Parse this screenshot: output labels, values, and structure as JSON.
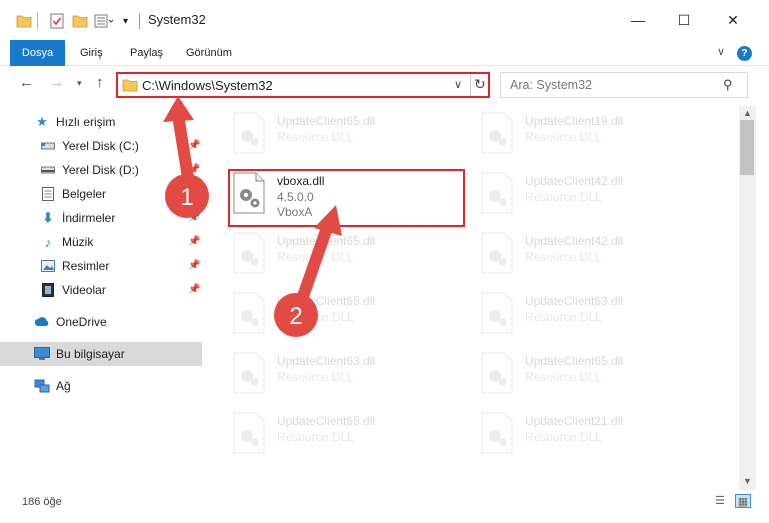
{
  "window": {
    "title": "System32",
    "minimize_glyph": "—",
    "maximize_glyph": "☐",
    "close_glyph": "✕"
  },
  "ribbon": {
    "tabs": [
      {
        "label": "Dosya"
      },
      {
        "label": "Giriş"
      },
      {
        "label": "Paylaş"
      },
      {
        "label": "Görünüm"
      }
    ],
    "help_glyph": "?"
  },
  "address": {
    "path": "C:\\Windows\\System32"
  },
  "search": {
    "placeholder": "Ara: System32"
  },
  "sidebar": {
    "items": [
      {
        "label": "Hızlı erişim",
        "icon": "star-icon"
      },
      {
        "label": "Yerel Disk (C:)",
        "icon": "drive-icon",
        "pinned": true
      },
      {
        "label": "Yerel Disk (D:)",
        "icon": "drive-icon",
        "pinned": true
      },
      {
        "label": "Belgeler",
        "icon": "documents-icon",
        "pinned": true
      },
      {
        "label": "İndirmeler",
        "icon": "download-icon",
        "pinned": true
      },
      {
        "label": "Müzik",
        "icon": "music-icon",
        "pinned": true
      },
      {
        "label": "Resimler",
        "icon": "pictures-icon",
        "pinned": true
      },
      {
        "label": "Videolar",
        "icon": "video-icon",
        "pinned": true
      },
      {
        "label": "OneDrive",
        "icon": "cloud-icon"
      },
      {
        "label": "Bu bilgisayar",
        "icon": "computer-icon",
        "selected": true
      },
      {
        "label": "Ağ",
        "icon": "network-icon"
      }
    ]
  },
  "files": {
    "left_column": [
      {
        "name": "UpdateClient65.dll",
        "desc": "Resource DLL"
      },
      {
        "name": "vboxa.dll",
        "version": "4.5.0.0",
        "desc": "VboxA",
        "highlighted": true
      },
      {
        "name": "UpdateClient65.dll",
        "desc": "Resource DLL"
      },
      {
        "name": "UpdateClient65.dll",
        "desc": "Resource DLL"
      },
      {
        "name": "UpdateClient63.dll",
        "desc": "Resource DLL"
      },
      {
        "name": "UpdateClient65.dll",
        "desc": "Resource DLL"
      }
    ],
    "right_column": [
      {
        "name": "UpdateClient19.dll",
        "desc": "Resource DLL"
      },
      {
        "name": "UpdateClient42.dll",
        "desc": "Resource DLL"
      },
      {
        "name": "UpdateClient42.dll",
        "desc": "Resource DLL"
      },
      {
        "name": "UpdateClient63.dll",
        "desc": "Resource DLL"
      },
      {
        "name": "UpdateClient65.dll",
        "desc": "Resource DLL"
      },
      {
        "name": "UpdateClient21.dll",
        "desc": "Resource DLL"
      }
    ]
  },
  "status": {
    "item_count": "186 öğe"
  },
  "annotations": {
    "step1": "1",
    "step2": "2",
    "color": "#e24b43"
  },
  "colors": {
    "accent": "#1979ca",
    "highlight_border": "#e02626"
  }
}
